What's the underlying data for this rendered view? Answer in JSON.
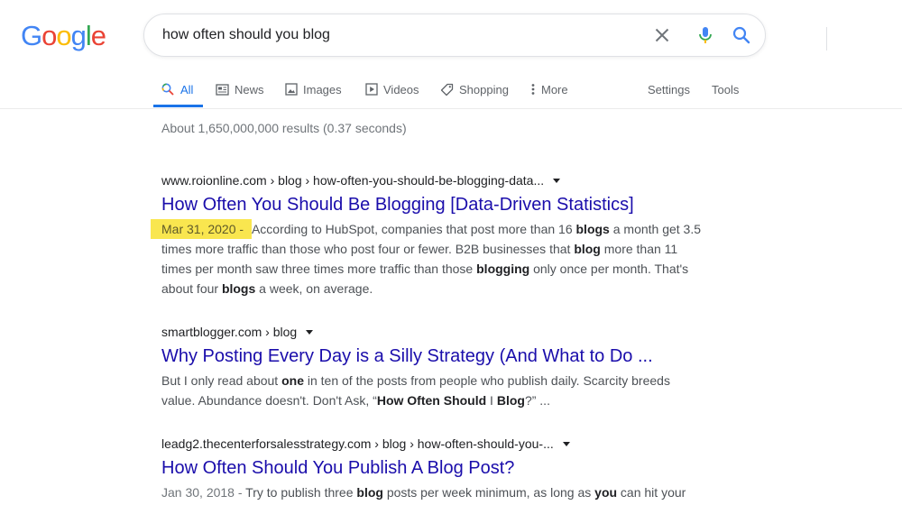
{
  "logo": {
    "letters": [
      "G",
      "o",
      "o",
      "g",
      "l",
      "e"
    ],
    "colors": [
      "#4285f4",
      "#ea4335",
      "#fbbc05",
      "#4285f4",
      "#34a853",
      "#ea4335"
    ]
  },
  "search": {
    "query": "how often should you blog"
  },
  "tabs": {
    "all": "All",
    "news": "News",
    "images": "Images",
    "videos": "Videos",
    "shopping": "Shopping",
    "more": "More",
    "settings": "Settings",
    "tools": "Tools"
  },
  "stats": "About 1,650,000,000 results (0.37 seconds)",
  "results": [
    {
      "url": "www.roionline.com › blog › how-often-you-should-be-blogging-data...",
      "title": "How Often You Should Be Blogging [Data-Driven Statistics]",
      "date": "Mar 31, 2020",
      "separator": " - ",
      "s1": "According to HubSpot, companies that post more than 16 ",
      "b1": "blogs",
      "s2": " a month get 3.5 times more traffic than those who post four or fewer. B2B businesses that ",
      "b2": "blog",
      "s3": " more than 11 times per month saw three times more traffic than those ",
      "b3": "blogging",
      "s4": " only once per month. That's about four ",
      "b4": "blogs",
      "s5": " a week, on average."
    },
    {
      "url": "smartblogger.com › blog",
      "title": "Why Posting Every Day is a Silly Strategy (And What to Do ...",
      "s1": "But I only read about ",
      "b1": "one",
      "s2": " in ten of the posts from people who publish daily. Scarcity breeds value. Abundance doesn't. Don't Ask, “",
      "b2": "How Often Should",
      "s3": " I ",
      "b3": "Blog",
      "s4": "?” ..."
    },
    {
      "url": "leadg2.thecenterforsalesstrategy.com › blog › how-often-should-you-...",
      "title": "How Often Should You Publish A Blog Post?",
      "date": "Jan 30, 2018",
      "separator": " - ",
      "s1": "Try to publish three ",
      "b1": "blog",
      "s2": " posts per week minimum, as long as ",
      "b2": "you",
      "s3": " can hit your"
    }
  ]
}
